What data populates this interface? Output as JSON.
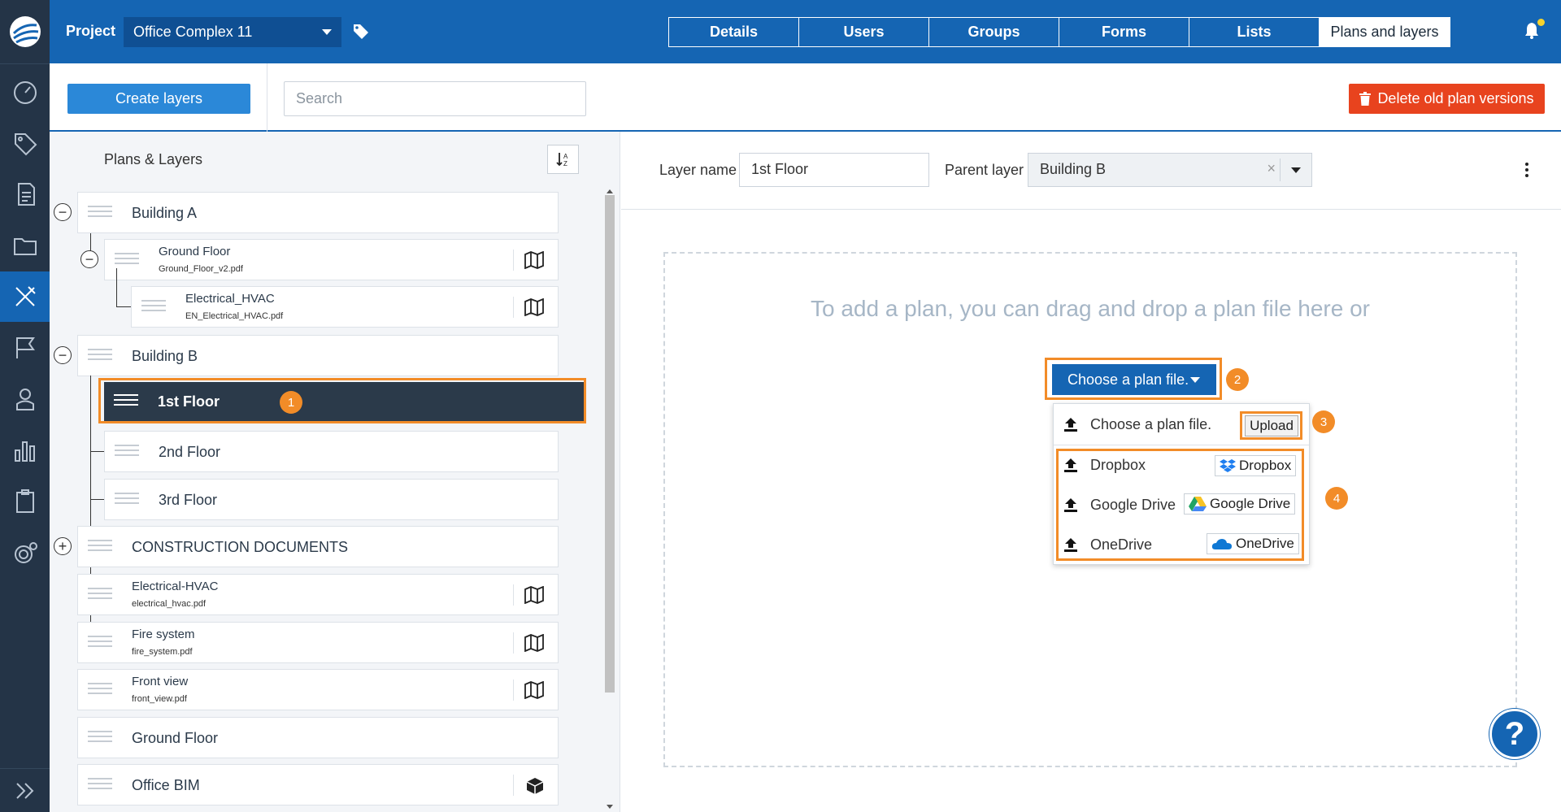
{
  "header": {
    "project_label": "Project",
    "project_name": "Office Complex 11",
    "tabs": [
      {
        "label": "Details"
      },
      {
        "label": "Users"
      },
      {
        "label": "Groups"
      },
      {
        "label": "Forms"
      },
      {
        "label": "Lists"
      },
      {
        "label": "Plans and layers",
        "active": true
      }
    ]
  },
  "toolbar": {
    "create_label": "Create layers",
    "search_placeholder": "Search",
    "delete_label": "Delete old plan versions"
  },
  "left": {
    "title": "Plans & Layers",
    "rows": [
      {
        "name": "Building A"
      },
      {
        "name": "Ground Floor",
        "file": "Ground_Floor_v2.pdf"
      },
      {
        "name": "Electrical_HVAC",
        "file": "EN_Electrical_HVAC.pdf"
      },
      {
        "name": "Building B"
      },
      {
        "name": "1st Floor",
        "selected": true
      },
      {
        "name": "2nd Floor"
      },
      {
        "name": "3rd Floor"
      },
      {
        "name": "CONSTRUCTION DOCUMENTS"
      },
      {
        "name": "Electrical-HVAC",
        "file": "electrical_hvac.pdf"
      },
      {
        "name": "Fire system",
        "file": "fire_system.pdf"
      },
      {
        "name": "Front view",
        "file": "front_view.pdf"
      },
      {
        "name": "Ground Floor"
      },
      {
        "name": "Office BIM"
      }
    ]
  },
  "right": {
    "layer_name_label": "Layer name",
    "layer_name_value": "1st Floor",
    "parent_layer_label": "Parent layer",
    "parent_layer_value": "Building B",
    "drop_text": "To add a plan, you can drag and drop a plan file here or",
    "choose_label": "Choose a plan file.",
    "menu": {
      "local_label": "Choose a plan file.",
      "upload_label": "Upload",
      "providers": [
        {
          "label": "Dropbox",
          "badge": "Dropbox"
        },
        {
          "label": "Google Drive",
          "badge": "Google Drive"
        },
        {
          "label": "OneDrive",
          "badge": "OneDrive"
        }
      ]
    },
    "help_label": "?"
  },
  "callouts": [
    "1",
    "2",
    "3",
    "4"
  ],
  "colors": {
    "primary": "#1565b3",
    "rail": "#243447",
    "danger": "#e8431e",
    "highlight": "#f28c28",
    "selected_row": "#2b3a4a"
  }
}
